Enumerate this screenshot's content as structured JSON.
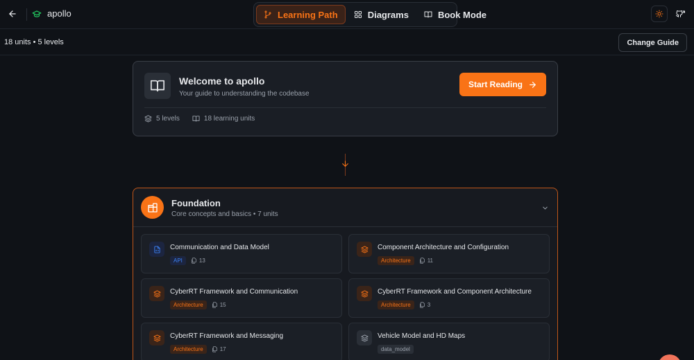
{
  "app": {
    "name": "apollo"
  },
  "modes": [
    {
      "label": "Learning Path",
      "active": true
    },
    {
      "label": "Diagrams",
      "active": false
    },
    {
      "label": "Book Mode",
      "active": false
    }
  ],
  "subbar": {
    "meta": "18 units • 5 levels",
    "change_guide": "Change Guide"
  },
  "welcome": {
    "title": "Welcome to apollo",
    "subtitle": "Your guide to understanding the codebase",
    "start_label": "Start Reading",
    "levels": "5 levels",
    "units": "18 learning units"
  },
  "level": {
    "title": "Foundation",
    "subtitle": "Core concepts and basics • 7 units",
    "units": [
      {
        "title": "Communication and Data Model",
        "tag": "API",
        "tag_type": "api",
        "count": "13"
      },
      {
        "title": "Component Architecture and Configuration",
        "tag": "Architecture",
        "tag_type": "arch",
        "count": "11"
      },
      {
        "title": "CyberRT Framework and Communication",
        "tag": "Architecture",
        "tag_type": "arch",
        "count": "15"
      },
      {
        "title": "CyberRT Framework and Component Architecture",
        "tag": "Architecture",
        "tag_type": "arch",
        "count": "3"
      },
      {
        "title": "CyberRT Framework and Messaging",
        "tag": "Architecture",
        "tag_type": "arch",
        "count": "17"
      },
      {
        "title": "Vehicle Model and HD Maps",
        "tag": "data_model",
        "tag_type": "dm",
        "count": ""
      }
    ]
  },
  "colors": {
    "accent": "#f97316",
    "background": "#0f1217",
    "api_blue": "#3b82f6",
    "brand_green": "#22c55e"
  }
}
